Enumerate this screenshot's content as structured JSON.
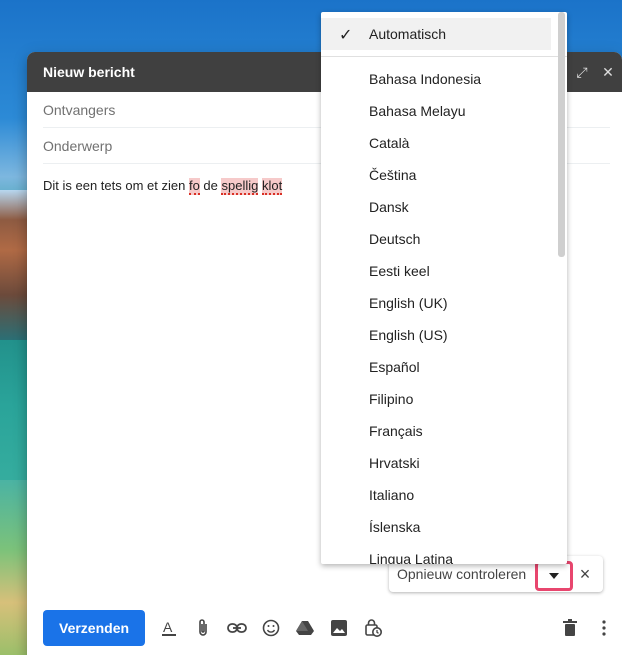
{
  "compose": {
    "title": "Nieuw bericht",
    "recipients_placeholder": "Ontvangers",
    "subject_placeholder": "Onderwerp",
    "body": [
      {
        "text": "Dit is een tets om et zien ",
        "error": false
      },
      {
        "text": "fo",
        "error": true
      },
      {
        "text": " de ",
        "error": false
      },
      {
        "text": "spellig",
        "error": true
      },
      {
        "text": " ",
        "error": false
      },
      {
        "text": "klot",
        "error": true
      }
    ],
    "send_label": "Verzenden"
  },
  "spellcheck": {
    "label": "Opnieuw controleren",
    "close_icon": "×"
  },
  "language_menu": {
    "selected": "Automatisch",
    "items": [
      "Bahasa Indonesia",
      "Bahasa Melayu",
      "Català",
      "Čeština",
      "Dansk",
      "Deutsch",
      "Eesti keel",
      "English (UK)",
      "English (US)",
      "Español",
      "Filipino",
      "Français",
      "Hrvatski",
      "Italiano",
      "Íslenska",
      "Lingua Latina"
    ]
  },
  "icons": {
    "expand": "expand-icon",
    "close": "close-icon",
    "format": "format-text-icon",
    "attach": "attachment-icon",
    "link": "link-icon",
    "emoji": "emoji-icon",
    "drive": "drive-icon",
    "photo": "photo-icon",
    "confidential": "confidential-icon",
    "trash": "trash-icon",
    "more": "more-options-icon"
  }
}
